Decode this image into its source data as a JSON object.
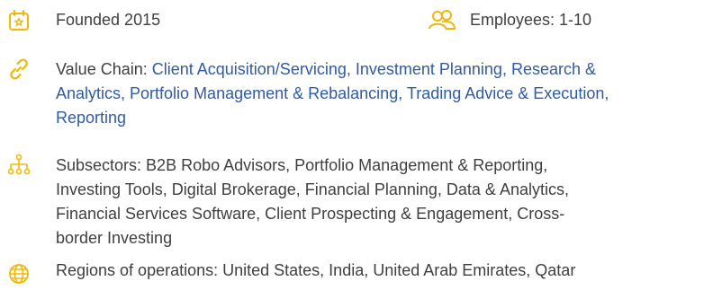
{
  "colors": {
    "accent": "#f2b705",
    "link": "#2f5aa8",
    "text": "#3f3f3f"
  },
  "founded": {
    "icon": "calendar-star-icon",
    "label": "Founded 2015"
  },
  "employees": {
    "icon": "people-icon",
    "label": "Employees: 1-10"
  },
  "value_chain": {
    "icon": "link-icon",
    "prefix": "Value Chain: ",
    "line1": "Client Acquisition/Servicing, Investment Planning, Research &",
    "line2": "Analytics, Portfolio Management & Rebalancing, Trading Advice & Execution,",
    "line3": "Reporting"
  },
  "subsectors": {
    "icon": "hierarchy-icon",
    "line1": "Subsectors: B2B Robo Advisors, Portfolio Management & Reporting,",
    "line2": "Investing Tools, Digital Brokerage, Financial Planning, Data & Analytics,",
    "line3": "Financial Services Software, Client Prospecting & Engagement, Cross-",
    "line4": "border Investing"
  },
  "regions": {
    "icon": "globe-icon",
    "label": "Regions of operations: United States, India, United Arab Emirates, Qatar"
  }
}
